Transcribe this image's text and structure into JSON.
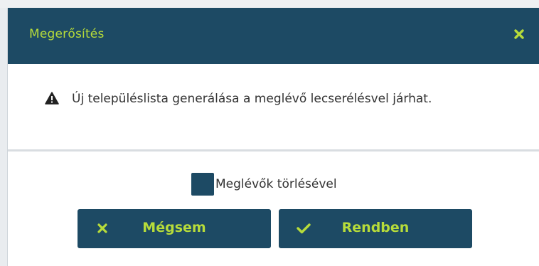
{
  "dialog": {
    "title": "Megerősítés",
    "close_icon": "close-icon",
    "message": "Új településlista generálása a meglévő lecserélésvel járhat.",
    "message_icon": "warning-icon",
    "checkbox": {
      "label": "Meglévők törlésével",
      "checked": false
    },
    "buttons": {
      "cancel": {
        "label": "Mégsem",
        "icon": "x-icon"
      },
      "ok": {
        "label": "Rendben",
        "icon": "checkmark-icon"
      }
    }
  },
  "colors": {
    "header_bg": "#1d4a64",
    "accent": "#b7dc3a",
    "text": "#333333",
    "divider": "#d9dde1"
  }
}
